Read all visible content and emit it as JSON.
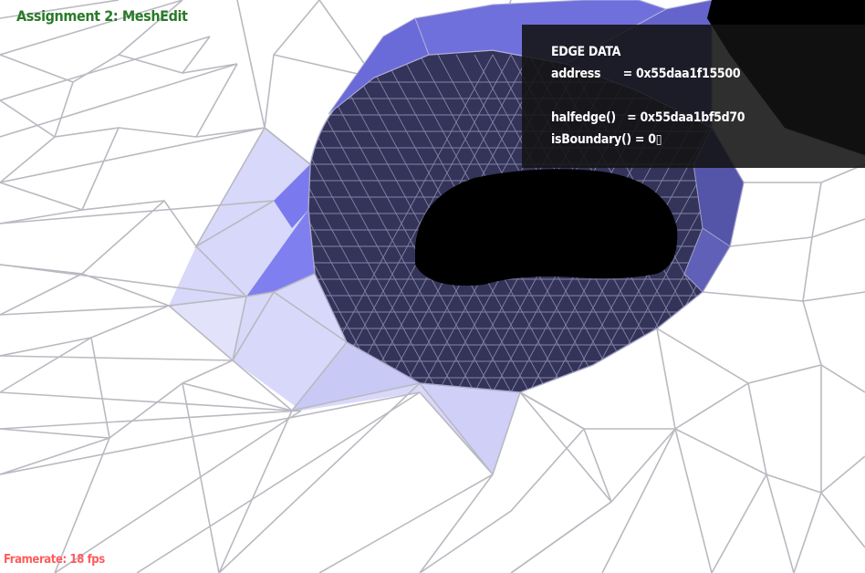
{
  "window": {
    "title": "Assignment 2: MeshEdit"
  },
  "info_panel": {
    "heading": "EDGE DATA",
    "address_line": "address      = 0x55daa1f15500",
    "halfedge_line": "halfedge()   = 0x55daa1bf5d70",
    "boundary_line": "isBoundary() = 0▯"
  },
  "status": {
    "framerate": "Framerate: 18 fps"
  },
  "colors": {
    "mesh_face": "#ffffff",
    "mesh_edge": "#b4b4bc",
    "selection_tint": "#8a8af0",
    "inner_surface": "#36365a",
    "hole": "#000000",
    "title": "#2a7a2a",
    "framerate": "#ff5c5c"
  }
}
